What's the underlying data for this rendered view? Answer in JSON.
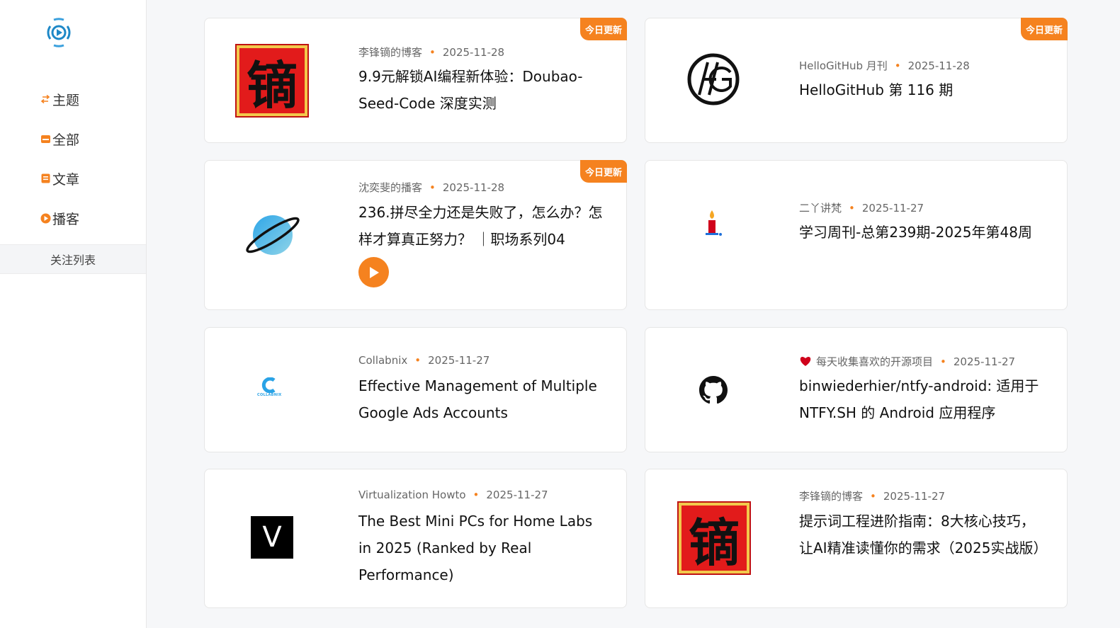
{
  "sidebar": {
    "logo_icon": "podcast-broadcast-icon",
    "nav": [
      {
        "label": "主题",
        "icon": "switch-arrows-icon"
      },
      {
        "label": "全部",
        "icon": "inbox-icon"
      },
      {
        "label": "文章",
        "icon": "document-icon"
      },
      {
        "label": "播客",
        "icon": "play-circle-icon"
      }
    ],
    "follow_label": "关注列表"
  },
  "accent_color": "#f5821f",
  "cards": [
    {
      "source": "李锋镝的博客",
      "date": "2025-11-28",
      "title": "9.9元解锁AI编程新体验：Doubao-Seed-Code 深度实测",
      "badge": "今日更新",
      "seal_char": "镝",
      "thumb_icon": "calligraphy-seal-icon"
    },
    {
      "source": "HelloGitHub 月刊",
      "date": "2025-11-28",
      "title": "HelloGitHub 第 116 期",
      "badge": "今日更新",
      "thumb_icon": "hellogithub-logo-icon"
    },
    {
      "source": "沈奕斐的播客",
      "date": "2025-11-28",
      "title": "236.拼尽全力还是失败了，怎么办？怎样才算真正努力？ ｜职场系列04",
      "badge": "今日更新",
      "thumb_icon": "planet-icon"
    },
    {
      "source": "二丫讲梵",
      "date": "2025-11-27",
      "title": "学习周刊-总第239期-2025年第48周",
      "thumb_icon": "candle-icon"
    },
    {
      "source": "Collabnix",
      "date": "2025-11-27",
      "title": "Effective Management of Multiple Google Ads Accounts",
      "logo_text": "COLLABNIX",
      "thumb_icon": "collabnix-logo-icon"
    },
    {
      "source": "每天收集喜欢的开源项目",
      "date": "2025-11-27",
      "title": "binwiederhier/ntfy-android: 适用于 NTFY.SH 的 Android 应用程序",
      "thumb_icon": "github-icon",
      "source_icon": "heart-icon"
    },
    {
      "source": "Virtualization Howto",
      "date": "2025-11-27",
      "title": "The Best Mini PCs for Home Labs in 2025 (Ranked by Real Performance)",
      "thumb_letter": "V",
      "thumb_icon": "v-logo-icon"
    },
    {
      "source": "李锋镝的博客",
      "date": "2025-11-27",
      "title": "提示词工程进阶指南：8大核心技巧，让AI精准读懂你的需求（2025实战版）",
      "seal_char": "镝",
      "thumb_icon": "calligraphy-seal-icon"
    }
  ]
}
